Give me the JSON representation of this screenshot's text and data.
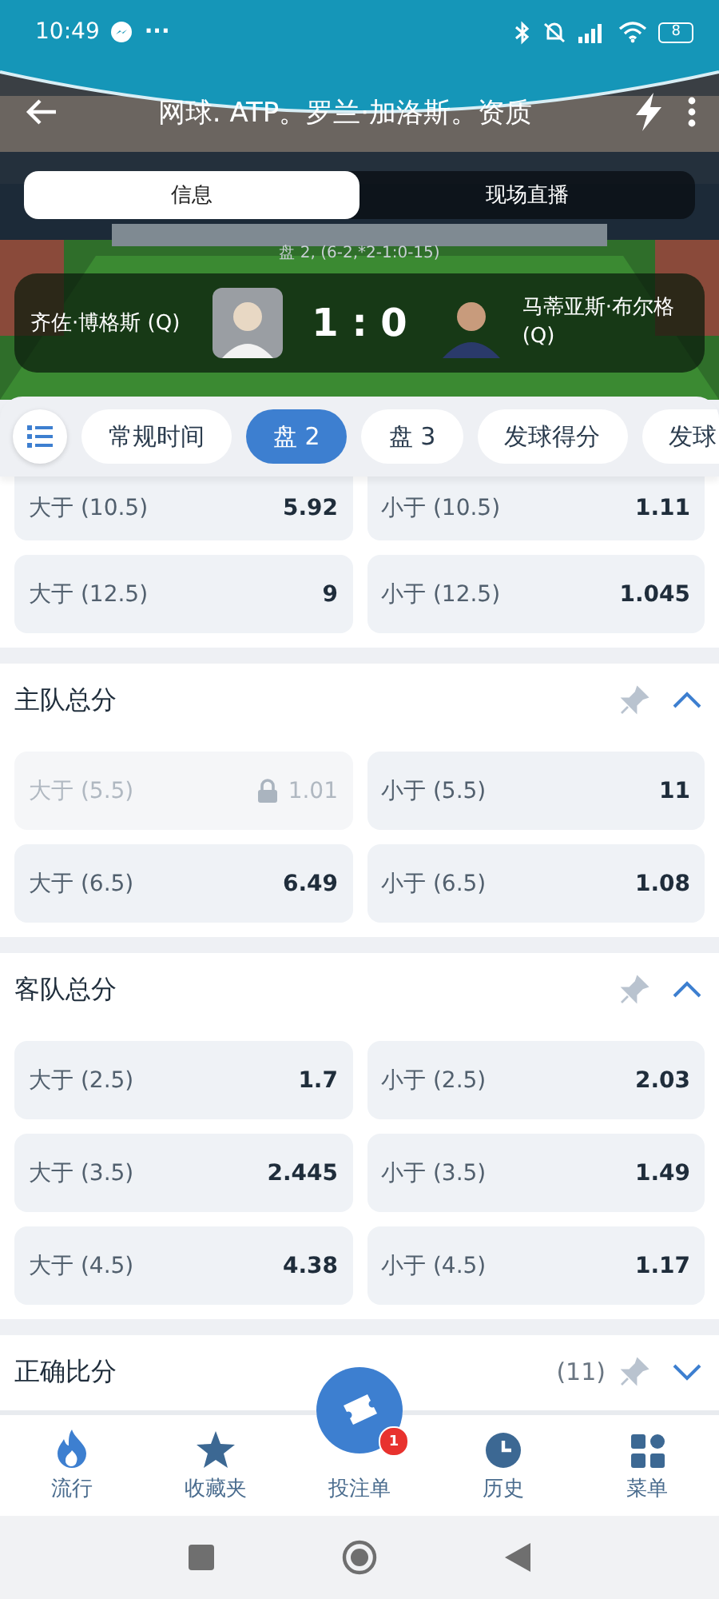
{
  "status_bar": {
    "time": "10:49",
    "more": "···",
    "battery": "8"
  },
  "header": {
    "title": "网球. ATP。罗兰·加洛斯。资质"
  },
  "tabs": [
    {
      "label": "信息",
      "selected": true
    },
    {
      "label": "现场直播",
      "selected": false
    }
  ],
  "match": {
    "set_info": "盘 2, (6-2,*2-1:0-15)",
    "home": "齐佐·博格斯 (Q)",
    "score": "1 : 0",
    "away": "马蒂亚斯·布尔格 (Q)"
  },
  "chips": [
    {
      "label": "常规时间",
      "selected": false
    },
    {
      "label": "盘 2",
      "selected": true
    },
    {
      "label": "盘 3",
      "selected": false
    },
    {
      "label": "发球得分",
      "selected": false
    },
    {
      "label": "发球",
      "selected": false
    }
  ],
  "sections": [
    {
      "rows": [
        [
          {
            "label": "大于 (10.5)",
            "odds": "5.92",
            "locked": false
          },
          {
            "label": "小于 (10.5)",
            "odds": "1.11",
            "locked": false
          }
        ],
        [
          {
            "label": "大于 (12.5)",
            "odds": "9",
            "locked": false
          },
          {
            "label": "小于 (12.5)",
            "odds": "1.045",
            "locked": false
          }
        ]
      ]
    },
    {
      "title": "主队总分",
      "expanded": true,
      "rows": [
        [
          {
            "label": "大于 (5.5)",
            "odds": "1.01",
            "locked": true
          },
          {
            "label": "小于 (5.5)",
            "odds": "11",
            "locked": false
          }
        ],
        [
          {
            "label": "大于 (6.5)",
            "odds": "6.49",
            "locked": false
          },
          {
            "label": "小于 (6.5)",
            "odds": "1.08",
            "locked": false
          }
        ]
      ]
    },
    {
      "title": "客队总分",
      "expanded": true,
      "rows": [
        [
          {
            "label": "大于 (2.5)",
            "odds": "1.7",
            "locked": false
          },
          {
            "label": "小于 (2.5)",
            "odds": "2.03",
            "locked": false
          }
        ],
        [
          {
            "label": "大于 (3.5)",
            "odds": "2.445",
            "locked": false
          },
          {
            "label": "小于 (3.5)",
            "odds": "1.49",
            "locked": false
          }
        ],
        [
          {
            "label": "大于 (4.5)",
            "odds": "4.38",
            "locked": false
          },
          {
            "label": "小于 (4.5)",
            "odds": "1.17",
            "locked": false
          }
        ]
      ]
    },
    {
      "title": "正确比分",
      "count": "(11)",
      "expanded": false
    }
  ],
  "bottom_nav": [
    {
      "kind": "fire",
      "label": "流行"
    },
    {
      "kind": "star",
      "label": "收藏夹"
    },
    {
      "kind": "ticket",
      "label": "投注单",
      "badge": "1"
    },
    {
      "kind": "clock",
      "label": "历史"
    },
    {
      "kind": "grid",
      "label": "菜单"
    }
  ]
}
